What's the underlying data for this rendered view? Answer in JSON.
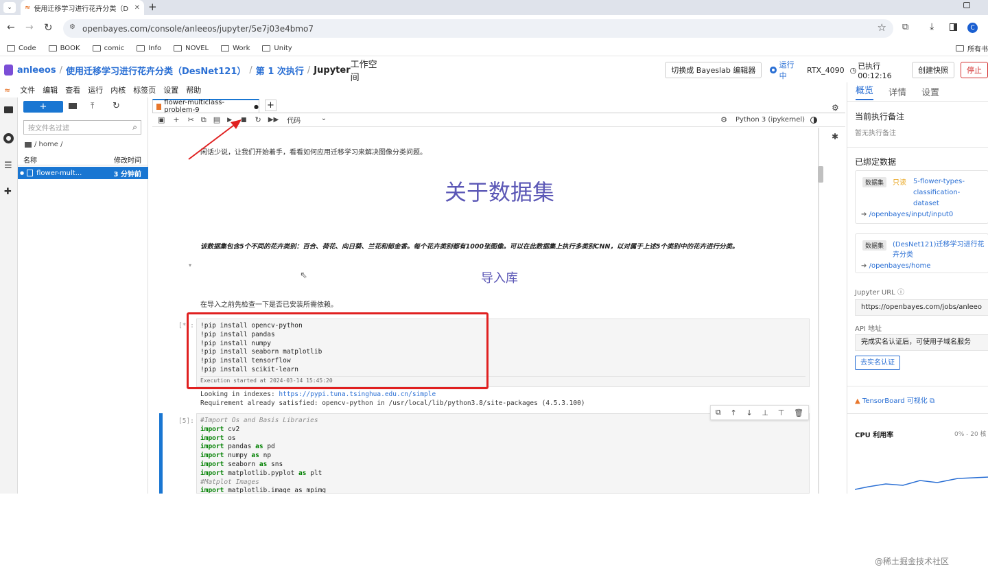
{
  "browser": {
    "tab_title": "使用迁移学习进行花卉分类（D",
    "url": "openbayes.com/console/anleeos/jupyter/5e7j03e4bmo7",
    "profile_initial": "C",
    "bookmarks": [
      "Code",
      "BOOK",
      "comic",
      "Info",
      "NOVEL",
      "Work",
      "Unity"
    ],
    "bookmarks_right": "所有书"
  },
  "header": {
    "user": "anleeos",
    "project": "使用迁移学习进行花卉分类（DesNet121）",
    "run": "第 1 次执行",
    "workspace_bold": "Jupyter",
    "workspace_rest": " 工作空间",
    "switch_btn": "切换成 Bayeslab 编辑器",
    "status": "运行中",
    "gpu": "RTX_4090",
    "elapsed": "已执行 00:12:16",
    "snapshot_btn": "创建快照",
    "stop_btn": "停止"
  },
  "menu": [
    "文件",
    "编辑",
    "查看",
    "运行",
    "内核",
    "标签页",
    "设置",
    "帮助"
  ],
  "filebrowser": {
    "new_btn": "+",
    "filter_placeholder": "按文件名过滤",
    "path": "/ home /",
    "col_name": "名称",
    "col_modified": "修改时间",
    "file_name": "flower-mult...",
    "file_time": "3 分钟前"
  },
  "notebook": {
    "tab_name": "flower-multiclass-problem-9",
    "cell_type": "代码",
    "kernel": "Python 3 (ipykernel)",
    "intro": "闲话少说，让我们开始着手，看看如何应用迁移学习来解决图像分类问题。",
    "h1": "关于数据集",
    "desc": "该数据集包含5个不同的花卉类别：百合、荷花、向日葵、兰花和郁金香。每个花卉类别都有1000张图像。可以在此数据集上执行多类别CNN，以对属于上述5个类别中的花卉进行分类。",
    "h2": "导入库",
    "check_text": "在导入之前先检查一下是否已安装所需依赖。",
    "cell1_prompt": "[*]:",
    "cell1_lines": [
      "!pip install opencv-python",
      "!pip install pandas",
      "!pip install numpy",
      "!pip install seaborn matplotlib",
      "!pip install tensorflow",
      "!pip install scikit-learn"
    ],
    "cell1_exec": "Execution started at 2024-03-14 15:45:20",
    "cell1_out1_prefix": "Looking in indexes: ",
    "cell1_out1_link": "https://pypi.tuna.tsinghua.edu.cn/simple",
    "cell1_out2": "Requirement already satisfied: opencv-python in /usr/local/lib/python3.8/site-packages (4.5.3.100)",
    "cell2_prompt": "[5]:",
    "cell2_comment1": "#Import Os and Basis Libraries",
    "cell2_l1": "cv2",
    "cell2_l2": "os",
    "cell2_l3a": "pandas",
    "cell2_l3b": "pd",
    "cell2_l4a": "numpy",
    "cell2_l4b": "np",
    "cell2_l5a": "seaborn",
    "cell2_l5b": "sns",
    "cell2_l6a": "matplotlib.pyplot",
    "cell2_l6b": "plt",
    "cell2_comment2": "#Matplot Images",
    "cell2_l7": "matplotlib.image as mpimg",
    "kw_import": "import",
    "kw_as": "as"
  },
  "right_panel": {
    "tabs": [
      "概览",
      "详情",
      "设置"
    ],
    "notes_title": "当前执行备注",
    "notes_empty": "暂无执行备注",
    "bound_title": "已绑定数据",
    "ds1_tag": "数据集",
    "ds1_ro": "只读",
    "ds1_name": "5-flower-types-classification-dataset",
    "ds1_path": "/openbayes/input/input0",
    "ds2_tag": "数据集",
    "ds2_name": "(DesNet121)迁移学习进行花卉分类",
    "ds2_path": "/openbayes/home",
    "jupyter_url_label": "Jupyter URL",
    "jupyter_url": "https://openbayes.com/jobs/anleeo",
    "api_label": "API 地址",
    "api_text": "完成实名认证后，可使用子域名服务",
    "verify_btn": "去实名认证",
    "tensorboard": "TensorBoard 可视化",
    "cpu_label": "CPU 利用率",
    "cpu_range": "0% - 20 核"
  },
  "watermark": "@稀土掘金技术社区",
  "colors": {
    "accent": "#2a6fd4",
    "highlight": "#e02020",
    "stop": "#d32f2f",
    "selected": "#1976d2"
  }
}
